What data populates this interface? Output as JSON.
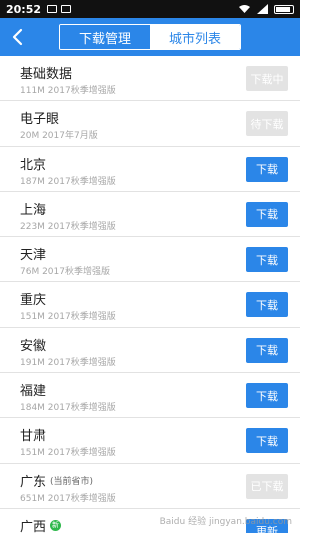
{
  "status_bar": {
    "time": "20:52",
    "left_icons": [
      "image-icon",
      "image-icon"
    ],
    "right_icons": [
      "wifi-icon",
      "signal-icon",
      "battery-icon"
    ]
  },
  "nav": {
    "back_icon": "chevron-left-icon",
    "tabs": [
      {
        "label": "下载管理",
        "active": false
      },
      {
        "label": "城市列表",
        "active": true
      }
    ]
  },
  "rows": [
    {
      "name": "基础数据",
      "tag": "",
      "meta": "111M 2017秋季增强版",
      "button": "下载中",
      "button_state": "disabled"
    },
    {
      "name": "电子眼",
      "tag": "",
      "meta": "20M 2017年7月版",
      "button": "待下载",
      "button_state": "disabled"
    },
    {
      "name": "北京",
      "tag": "",
      "meta": "187M 2017秋季增强版",
      "button": "下载",
      "button_state": "active"
    },
    {
      "name": "上海",
      "tag": "",
      "meta": "223M 2017秋季增强版",
      "button": "下载",
      "button_state": "active"
    },
    {
      "name": "天津",
      "tag": "",
      "meta": "76M 2017秋季增强版",
      "button": "下载",
      "button_state": "active"
    },
    {
      "name": "重庆",
      "tag": "",
      "meta": "151M 2017秋季增强版",
      "button": "下载",
      "button_state": "active"
    },
    {
      "name": "安徽",
      "tag": "",
      "meta": "191M 2017秋季增强版",
      "button": "下载",
      "button_state": "active"
    },
    {
      "name": "福建",
      "tag": "",
      "meta": "184M 2017秋季增强版",
      "button": "下载",
      "button_state": "active"
    },
    {
      "name": "甘肃",
      "tag": "",
      "meta": "151M 2017秋季增强版",
      "button": "下载",
      "button_state": "active"
    },
    {
      "name": "广东",
      "tag": "(当前省市)",
      "meta": "651M 2017秋季增强版",
      "button": "已下载",
      "button_state": "disabled"
    },
    {
      "name": "广西",
      "tag": "",
      "new_badge": "新",
      "meta": "",
      "button": "更新",
      "button_state": "active"
    }
  ],
  "watermark": "Baidu 经验 jingyan.baidu.com",
  "colors": {
    "accent": "#2b86e8",
    "disabled": "#e3e3e3",
    "new_badge": "#2fb84c"
  }
}
